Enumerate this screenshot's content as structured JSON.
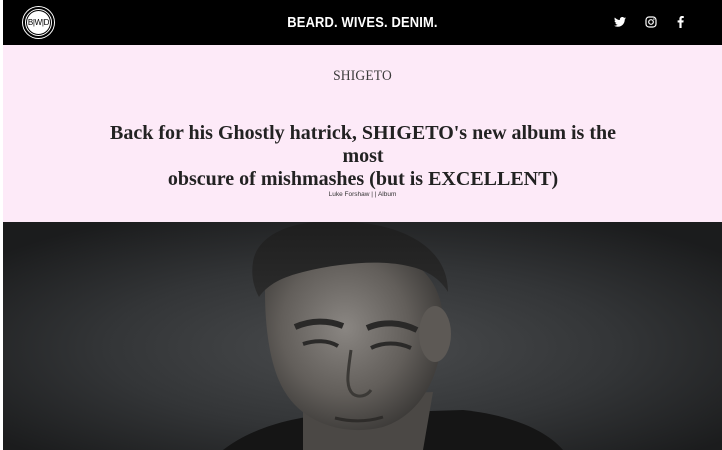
{
  "header": {
    "logo_text": "B|W|D",
    "site_title": "BEARD. WIVES. DENIM.",
    "social": [
      {
        "icon": "twitter-icon"
      },
      {
        "icon": "instagram-icon"
      },
      {
        "icon": "facebook-icon"
      }
    ]
  },
  "article": {
    "artist": "SHIGETO",
    "headline_line1": "Back for his Ghostly hatrick, SHIGETO's new album is the most",
    "headline_line2": "obscure of mishmashes (but is EXCELLENT)",
    "author": "Luke Forshaw",
    "separator": "|",
    "category": "Album"
  },
  "colors": {
    "header_bg": "#000000",
    "hero_bg": "#fdeaf8",
    "photo_bg": "#2a2b2c"
  }
}
